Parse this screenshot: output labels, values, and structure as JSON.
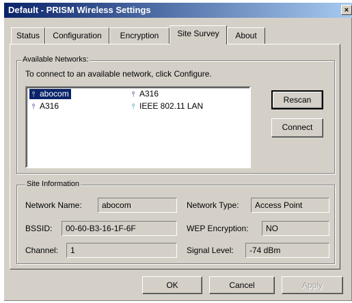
{
  "window": {
    "title": "Default - PRISM Wireless Settings",
    "close_glyph": "×"
  },
  "tabs": [
    {
      "label": "Status",
      "active": false
    },
    {
      "label": "Configuration",
      "active": false
    },
    {
      "label": "Encryption",
      "active": false
    },
    {
      "label": "Site Survey",
      "active": true
    },
    {
      "label": "About",
      "active": false
    }
  ],
  "available_networks": {
    "legend": "Available Networks:",
    "instruction": "To connect to an available network, click Configure.",
    "networks": [
      {
        "name": "abocom",
        "icon": "antenna-icon",
        "selected": true
      },
      {
        "name": "A316",
        "icon": "antenna-icon",
        "selected": false
      },
      {
        "name": "A316",
        "icon": "antenna-icon",
        "selected": false
      },
      {
        "name": "IEEE 802.11 LAN",
        "icon": "antenna-icon",
        "selected": false
      }
    ],
    "rescan_label": "Rescan",
    "connect_label": "Connect"
  },
  "site_information": {
    "legend": "Site Information",
    "network_name_label": "Network Name:",
    "network_name_value": "abocom",
    "network_type_label": "Network Type:",
    "network_type_value": "Access Point",
    "bssid_label": "BSSID:",
    "bssid_value": "00-60-B3-16-1F-6F",
    "wep_label": "WEP Encryption:",
    "wep_value": "NO",
    "channel_label": "Channel:",
    "channel_value": "1",
    "signal_label": "Signal Level:",
    "signal_value": "-74 dBm"
  },
  "footer": {
    "ok_label": "OK",
    "cancel_label": "Cancel",
    "apply_label": "Apply"
  },
  "colors": {
    "titlebar_start": "#0a246a",
    "titlebar_end": "#a6caf0",
    "face": "#d4d0c8",
    "selection": "#0a246a"
  }
}
